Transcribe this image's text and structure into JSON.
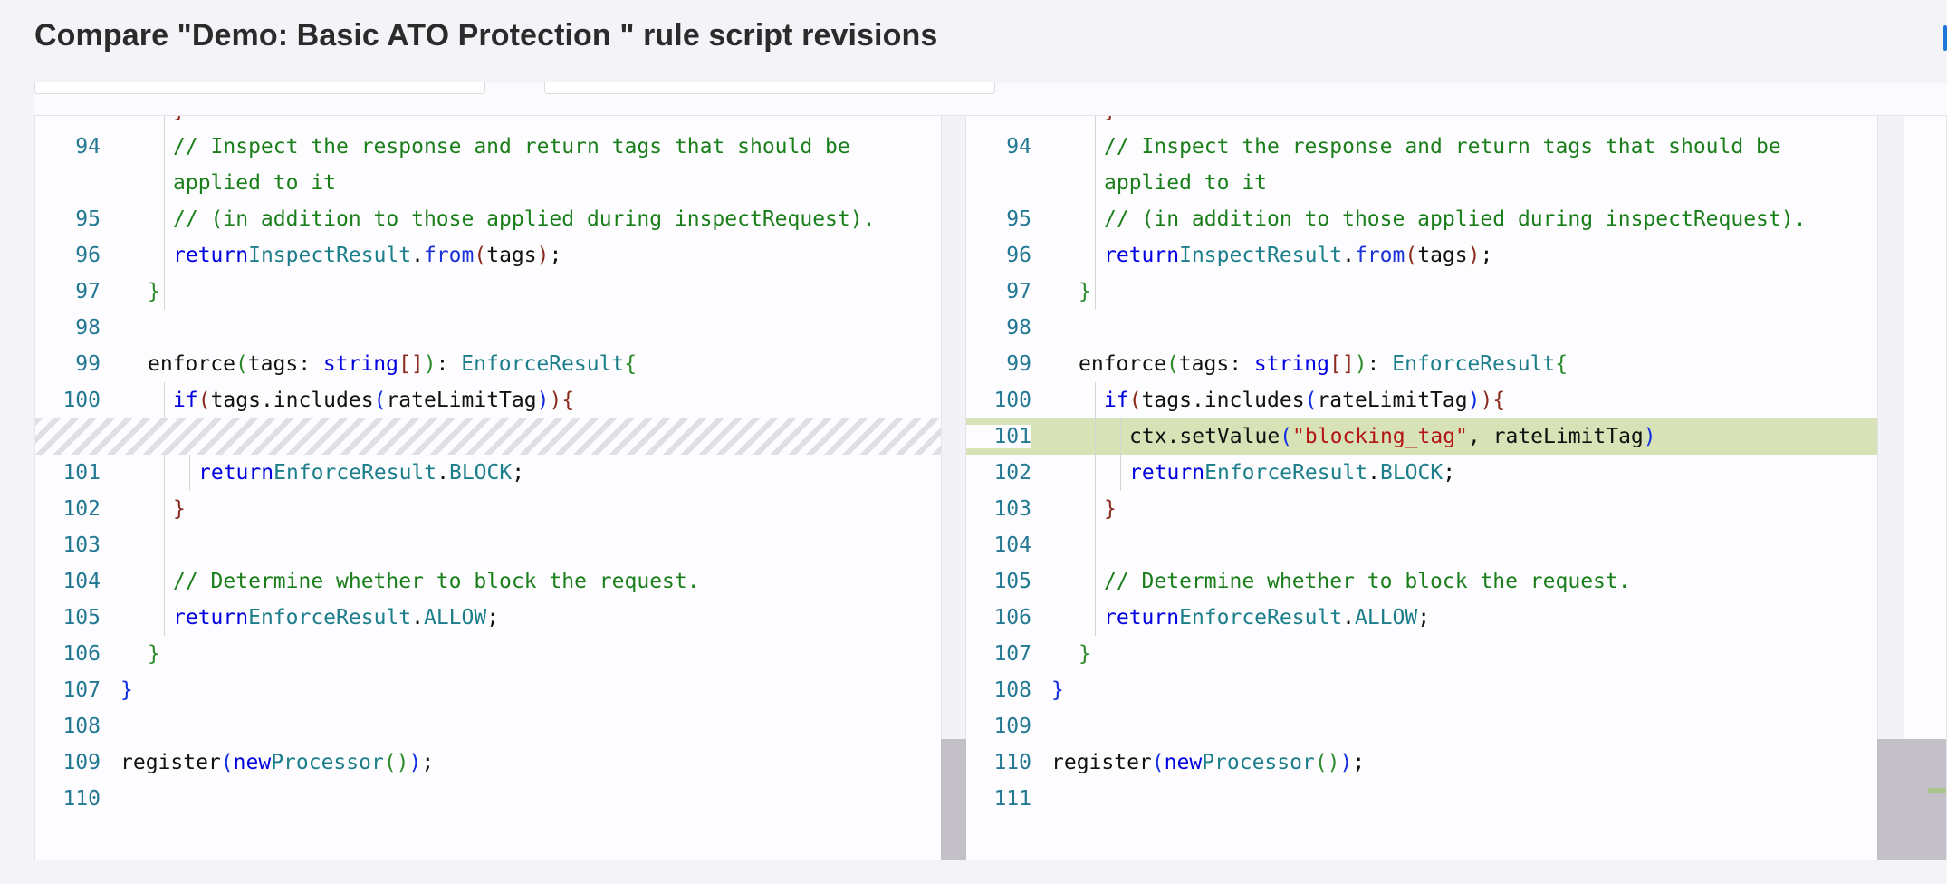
{
  "title": "Compare \"Demo: Basic ATO Protection \" rule script revisions",
  "left": {
    "numbers": [
      "94",
      "",
      "95",
      "96",
      "97",
      "98",
      "99",
      "100",
      "",
      "101",
      "102",
      "103",
      "104",
      "105",
      "106",
      "107",
      "108",
      "109",
      "110"
    ]
  },
  "right": {
    "numbers": [
      "94",
      "",
      "95",
      "96",
      "97",
      "98",
      "99",
      "100",
      "101",
      "102",
      "103",
      "104",
      "105",
      "106",
      "107",
      "108",
      "109",
      "110",
      "111"
    ]
  },
  "code": {
    "comment1a": "// Inspect the response and return tags that should be",
    "comment1b": "applied to it",
    "comment2": "// (in addition to those applied during inspectRequest).",
    "return_kw": "return",
    "inspect_result": "InspectResult",
    "from": "from",
    "tags": "tags",
    "enforce": "enforce",
    "tags_param": "tags",
    "string_type": "string",
    "enforce_result": "EnforceResult",
    "if_kw": "if",
    "includes_call": "tags.includes",
    "rate_limit_tag": "rateLimitTag",
    "set_value_call": "ctx.setValue",
    "blocking_tag": "\"blocking_tag\"",
    "block": "BLOCK",
    "allow": "ALLOW",
    "comment3": "// Determine whether to block the request.",
    "register": "register",
    "new_kw": "new",
    "processor": "Processor"
  }
}
